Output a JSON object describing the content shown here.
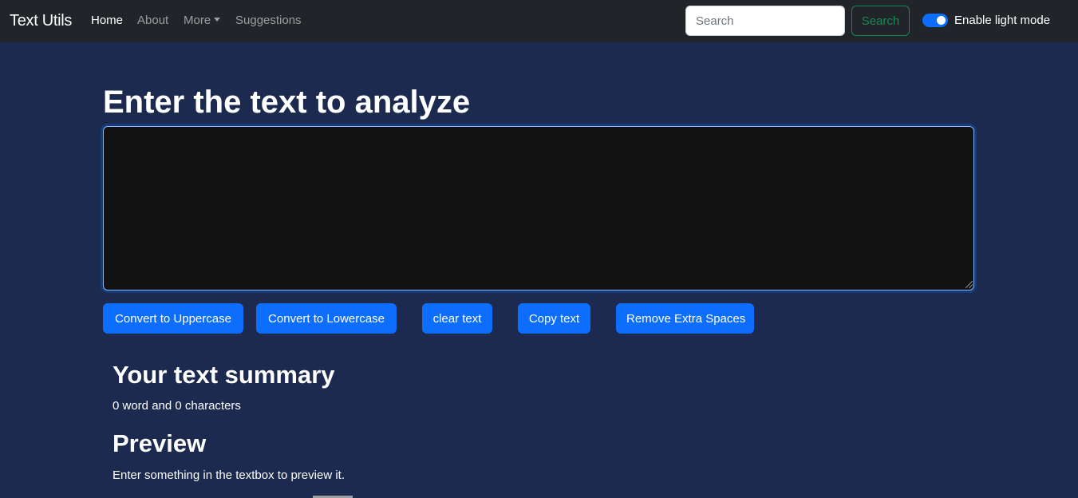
{
  "navbar": {
    "brand": "Text Utils",
    "links": [
      {
        "label": "Home",
        "active": true
      },
      {
        "label": "About",
        "active": false
      },
      {
        "label": "More",
        "active": false,
        "dropdown": true
      },
      {
        "label": "Suggestions",
        "active": false
      }
    ],
    "search": {
      "placeholder": "Search",
      "value": "",
      "button_label": "Search"
    },
    "mode_toggle": {
      "label": "Enable light mode",
      "checked": true
    }
  },
  "main": {
    "heading": "Enter the text to analyze",
    "textarea_value": "",
    "buttons": [
      {
        "label": "Convert to Uppercase"
      },
      {
        "label": "Convert to Lowercase"
      },
      {
        "label": "clear text"
      },
      {
        "label": "Copy text"
      },
      {
        "label": "Remove Extra Spaces"
      }
    ],
    "summary_heading": "Your text summary",
    "summary_text": "0 word and 0 characters",
    "preview_heading": "Preview",
    "preview_text": "Enter something in the textbox to preview it."
  },
  "colors": {
    "page_background": "#1b2a4e",
    "navbar_background": "#212529",
    "primary": "#0d6efd",
    "success": "#198754",
    "textarea_background": "#121212"
  }
}
